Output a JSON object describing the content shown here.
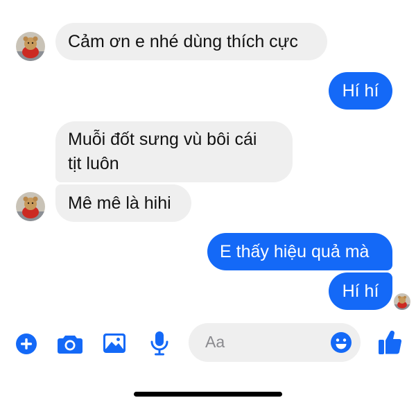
{
  "messages": [
    {
      "side": "incoming",
      "text": "Cảm ơn e nhé dùng thích cực"
    },
    {
      "side": "outgoing",
      "text": "Hí hí"
    },
    {
      "side": "incoming",
      "lines": [
        "Muỗi đốt sưng vù bôi cái",
        "tịt luôn"
      ]
    },
    {
      "side": "incoming",
      "text": "Mê mê là hihi"
    },
    {
      "side": "outgoing",
      "text": "E thấy hiệu quả mà"
    },
    {
      "side": "outgoing",
      "text": "Hí hí"
    }
  ],
  "composer": {
    "placeholder": "Aa",
    "icons": [
      "add-icon",
      "camera-icon",
      "gallery-icon",
      "microphone-icon",
      "emoji-icon",
      "thumbs-up-icon"
    ]
  },
  "colors": {
    "accent": "#1469f7",
    "incoming_bubble": "#efefef",
    "incoming_text": "#111111",
    "outgoing_text": "#ffffff"
  }
}
